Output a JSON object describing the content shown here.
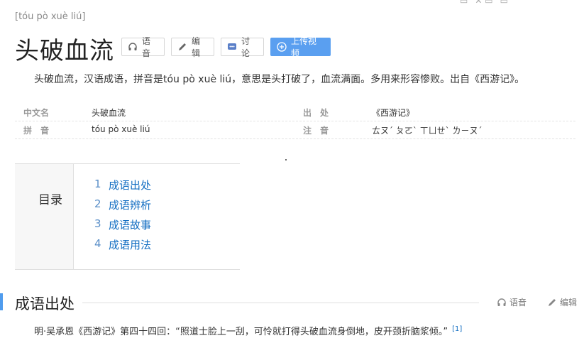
{
  "header": {
    "pinyin": "[tóu pò xuè liú]",
    "title": "头破血流"
  },
  "buttons": {
    "audio": "语音",
    "edit": "编辑",
    "discuss": "讨论",
    "upload": "上传视频"
  },
  "summary": "头破血流，汉语成语，拼音是tóu pò xuè liú，意思是头打破了，血流满面。多用来形容惨败。出自《西游记》。",
  "info": {
    "rows": [
      {
        "k1": "中文名",
        "v1": "头破血流",
        "k2": "出　处",
        "v2": "《西游记》"
      },
      {
        "k1": "拼　音",
        "v1": "tóu pò xuè liú",
        "k2": "注　音",
        "v2": "ㄊㄡˊ ㄆㄛˋ ㄒㄩㄝˋ ㄌㄧㄡˊ"
      }
    ]
  },
  "toc": {
    "title": "目录",
    "items": [
      {
        "num": "1",
        "label": "成语出处"
      },
      {
        "num": "2",
        "label": "成语辨析"
      },
      {
        "num": "3",
        "label": "成语故事"
      },
      {
        "num": "4",
        "label": "成语用法"
      }
    ]
  },
  "section": {
    "title": "成语出处",
    "audio": "语音",
    "edit": "编辑",
    "text": "明·吴承恩《西游记》第四十四回：“照道士脸上一刮，可怜就打得头破血流身倒地，皮开颈折脑浆倾。”",
    "ref": "[1]"
  },
  "colors": {
    "accent": "#5a9ff0",
    "link": "#136ec2",
    "section_bar": "#4f9cee"
  },
  "icons": [
    "headphone-icon",
    "pencil-icon",
    "chat-icon",
    "plus-circle-icon"
  ]
}
